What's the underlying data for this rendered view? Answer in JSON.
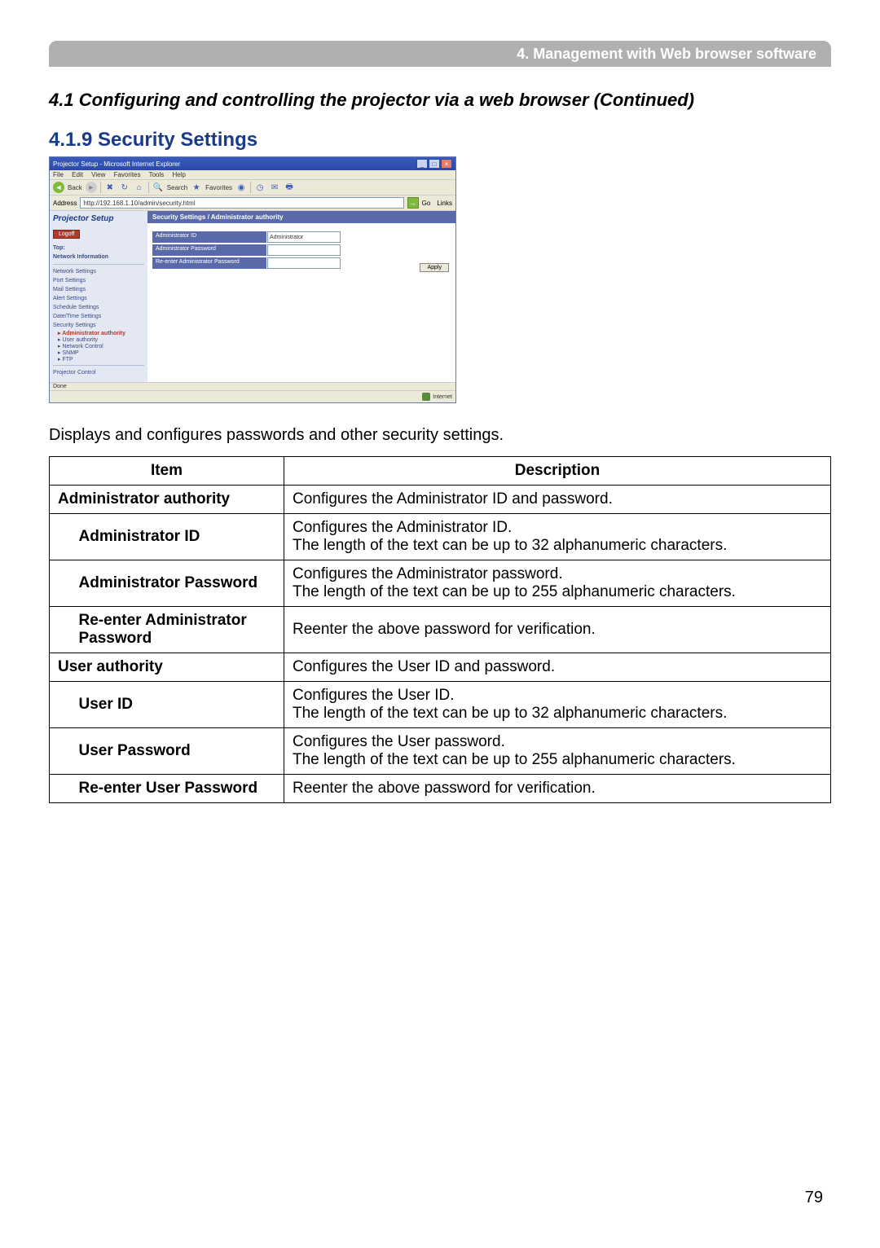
{
  "header_bar": "4. Management with Web browser software",
  "section_title": "4.1 Configuring and controlling the projector via a web browser (Continued)",
  "subsection_title": "4.1.9 Security Settings",
  "intro_text": "Displays and configures passwords and other security settings.",
  "page_number": "79",
  "table": {
    "header_item": "Item",
    "header_desc": "Description",
    "rows": [
      {
        "type": "group",
        "item": "Administrator authority",
        "desc": "Configures the Administrator ID and password."
      },
      {
        "type": "sub",
        "item": "Administrator ID",
        "desc": "Configures the Administrator ID.\nThe length of the text can be up to 32 alphanumeric characters."
      },
      {
        "type": "sub",
        "item": "Administrator Password",
        "desc": "Configures the Administrator password.\nThe length of the text can be up to 255 alphanumeric characters."
      },
      {
        "type": "sub",
        "item": "Re-enter Administrator Password",
        "desc": "Reenter the above password for verification."
      },
      {
        "type": "group",
        "item": "User authority",
        "desc": "Configures the User ID and password."
      },
      {
        "type": "sub",
        "item": "User ID",
        "desc": "Configures the User ID.\nThe length of the text can be up to 32 alphanumeric characters."
      },
      {
        "type": "sub",
        "item": "User Password",
        "desc": "Configures the User password.\nThe length of the text can be up to 255 alphanumeric characters."
      },
      {
        "type": "sub",
        "item": "Re-enter User Password",
        "desc": "Reenter the above password for verification."
      }
    ]
  },
  "ie": {
    "title": "Projector Setup - Microsoft Internet Explorer",
    "menu": [
      "File",
      "Edit",
      "View",
      "Favorites",
      "Tools",
      "Help"
    ],
    "back": "Back",
    "search": "Search",
    "favorites": "Favorites",
    "address_label": "Address",
    "url": "http://192.168.1.10/admin/security.html",
    "go": "Go",
    "links": "Links",
    "sidebar_logo": "Projector Setup",
    "logoff": "Logoff",
    "nav_top": "Top:",
    "nav_network": "Network Information",
    "nav_items": [
      "Network Settings",
      "Port Settings",
      "Mail Settings",
      "Alert Settings",
      "Schedule Settings",
      "Date/Time Settings"
    ],
    "nav_security": "Security Settings",
    "nav_security_subs": [
      "Administrator authority",
      "User authority",
      "Network Control",
      "SNMP",
      "FTP"
    ],
    "nav_projector_control": "Projector Control",
    "main_header": "Security Settings / Administrator authority",
    "form": {
      "r1_label": "Administrator ID",
      "r1_value": "Administrator",
      "r2_label": "Administrator Password",
      "r2_value": "",
      "r3_label": "Re-enter Administrator Password",
      "r3_value": ""
    },
    "apply": "Apply",
    "status": "Internet",
    "done": "Done"
  }
}
